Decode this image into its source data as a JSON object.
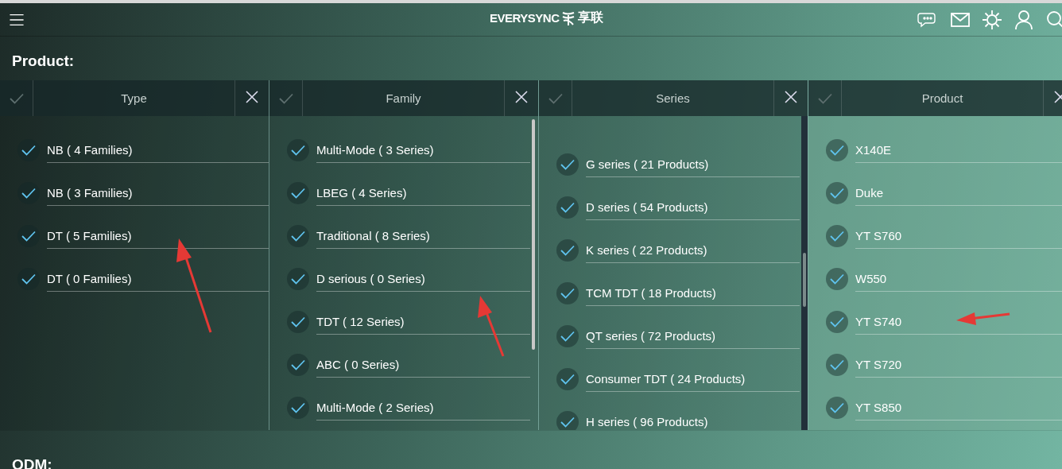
{
  "header": {
    "brand": "EVERYSYNC",
    "brand_chinese": "享联"
  },
  "section_title": "Product:",
  "columns": [
    {
      "title": "Type",
      "items": [
        {
          "label": "NB ( 4 Families)",
          "checked": true
        },
        {
          "label": "NB ( 3 Families)",
          "checked": true
        },
        {
          "label": "DT ( 5 Families)",
          "checked": true
        },
        {
          "label": "DT ( 0 Families)",
          "checked": true
        }
      ]
    },
    {
      "title": "Family",
      "items": [
        {
          "label": "Multi-Mode ( 3 Series)",
          "checked": true
        },
        {
          "label": "LBEG ( 4 Series)",
          "checked": true
        },
        {
          "label": "Traditional ( 8 Series)",
          "checked": true
        },
        {
          "label": "D serious ( 0 Series)",
          "checked": true
        },
        {
          "label": "TDT ( 12 Series)",
          "checked": true
        },
        {
          "label": "ABC ( 0 Series)",
          "checked": true
        },
        {
          "label": "Multi-Mode ( 2 Series)",
          "checked": true
        }
      ]
    },
    {
      "title": "Series",
      "items": [
        {
          "label": "G series ( 21 Products)",
          "checked": true
        },
        {
          "label": "D series ( 54 Products)",
          "checked": true
        },
        {
          "label": "K series ( 22 Products)",
          "checked": true
        },
        {
          "label": "TCM TDT ( 18 Products)",
          "checked": true
        },
        {
          "label": "QT series ( 72 Products)",
          "checked": true
        },
        {
          "label": "Consumer TDT ( 24 Products)",
          "checked": true
        },
        {
          "label": "H series ( 96 Products)",
          "checked": true
        }
      ]
    },
    {
      "title": "Product",
      "items": [
        {
          "label": "X140E",
          "checked": true
        },
        {
          "label": "Duke",
          "checked": true
        },
        {
          "label": "YT S760",
          "checked": true
        },
        {
          "label": "W550",
          "checked": true
        },
        {
          "label": "YT S740",
          "checked": true
        },
        {
          "label": "YT S720",
          "checked": true
        },
        {
          "label": "YT S850",
          "checked": true
        }
      ]
    }
  ],
  "next_section_title": "ODM:"
}
